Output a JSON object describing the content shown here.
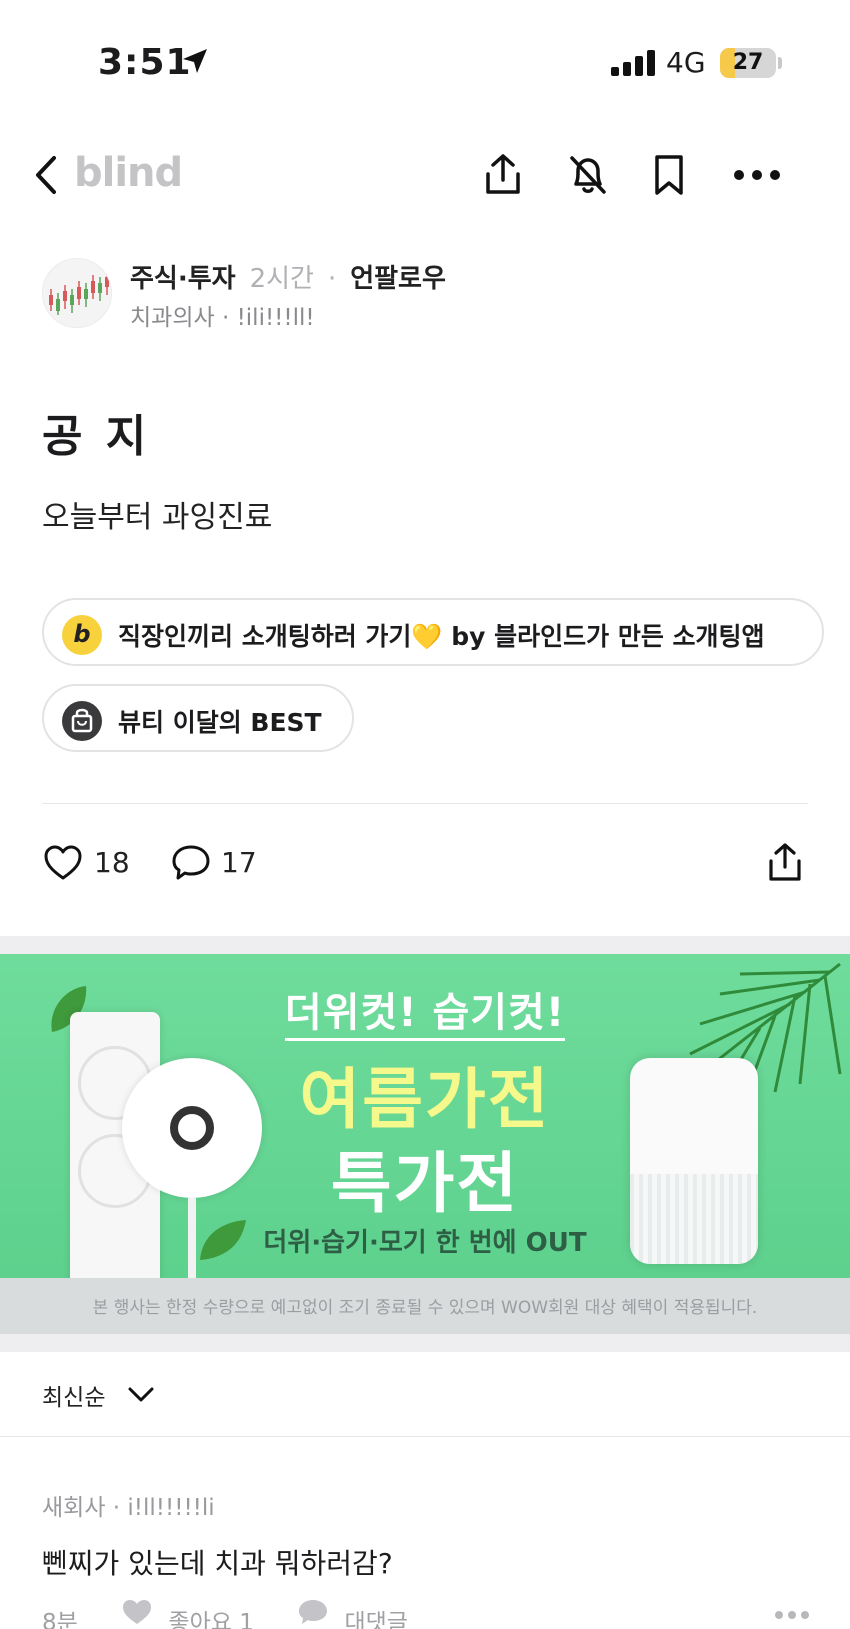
{
  "status": {
    "time": "3:51",
    "network": "4G",
    "battery": "27",
    "battery_level": 0.27
  },
  "nav": {
    "brand": "blind"
  },
  "post": {
    "topic": "주식·투자",
    "time_ago": "2시간",
    "separator": "·",
    "follow_label": "언팔로우",
    "author_line": "치과의사 · !ili!!!ll!",
    "title": "공 지",
    "body": "오늘부터 과잉진료"
  },
  "chips": [
    {
      "label": "직장인끼리 소개팅하러 가기💛 by 블라인드가 만든 소개팅앱",
      "icon": "b"
    },
    {
      "label": "뷰티 이달의 BEST"
    }
  ],
  "actions": {
    "likes": "18",
    "comments": "17"
  },
  "banner": {
    "headline1": "더위컷! 습기컷!",
    "headline2": "여름가전",
    "headline3": "특가전",
    "subline": "더위·습기·모기 한 번에 OUT",
    "note": "본 행사는 한정 수량으로 예고없이 조기 종료될 수 있으며 WOW회원 대상 혜택이 적용됩니다."
  },
  "sort": {
    "label": "최신순"
  },
  "comment": {
    "author": "새회사 · i!ll!!!!!li",
    "text": "뻰찌가 있는데 치과 뭐하러감?",
    "time": "8분",
    "like_label": "좋아요 1",
    "reply_label": "대댓글"
  },
  "colors": {
    "banner_green": "#5bcf8b",
    "banner_yellow_text": "#f5f88a",
    "battery_yellow": "#f6c94a",
    "chip_b_yellow": "#f7d23c"
  }
}
